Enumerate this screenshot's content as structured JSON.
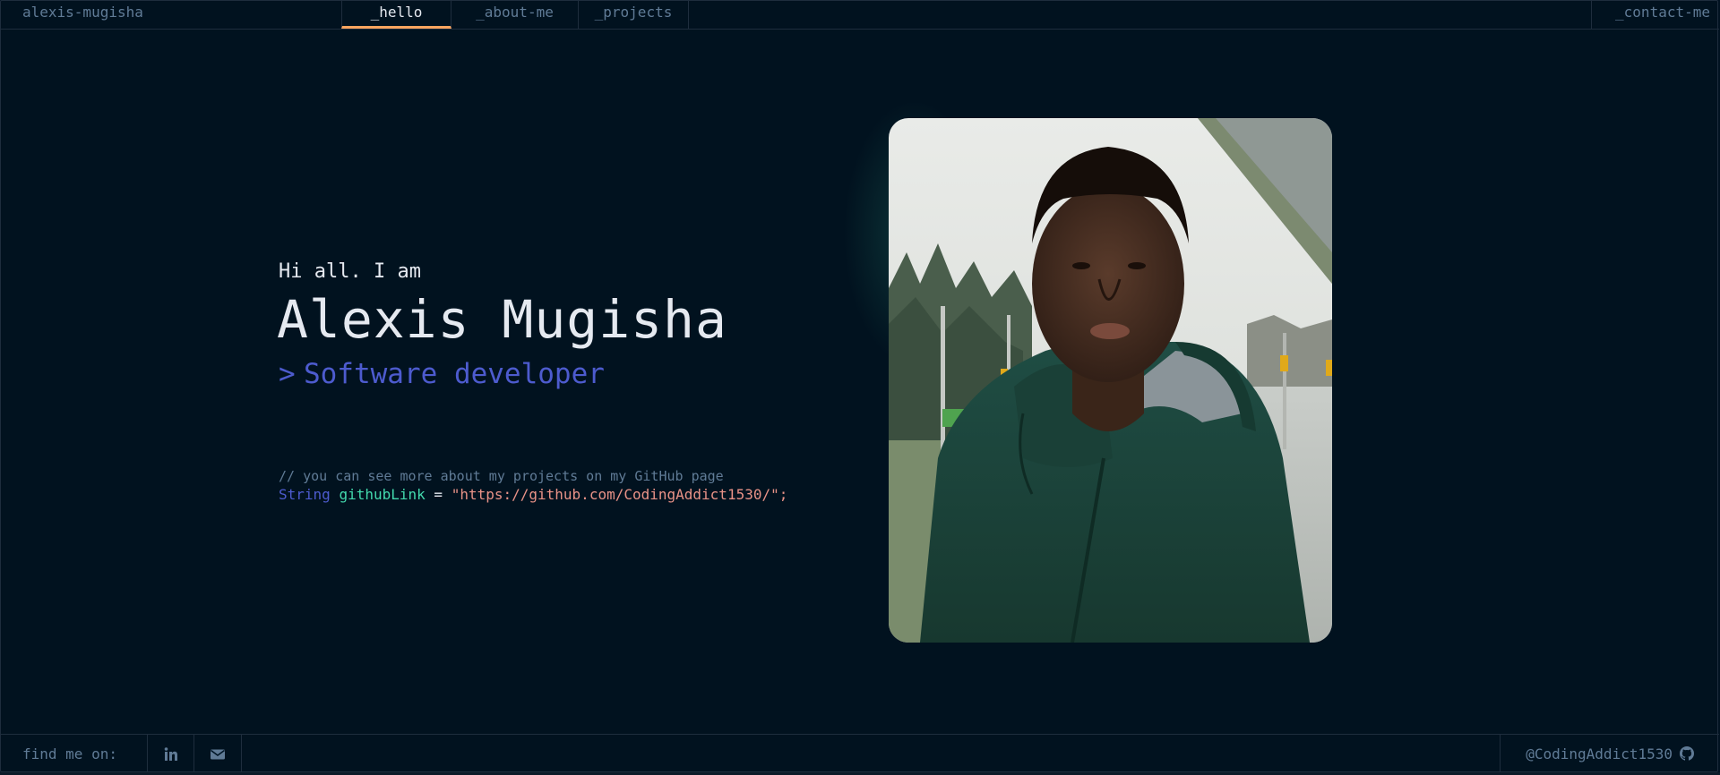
{
  "header": {
    "brand": "alexis-mugisha",
    "tabs": [
      {
        "label": "_hello",
        "active": true
      },
      {
        "label": "_about-me",
        "active": false
      },
      {
        "label": "_projects",
        "active": false
      }
    ],
    "contact_tab": "_contact-me"
  },
  "hero": {
    "greeting": "Hi all. I am",
    "name": "Alexis Mugisha",
    "role_prompt": ">",
    "role": "Software developer",
    "comment": "// you can see more about my projects on my GitHub page",
    "code": {
      "type_keyword": "String",
      "variable": "githubLink",
      "operator": "=",
      "value": "\"https://github.com/CodingAddict1530/\";"
    }
  },
  "footer": {
    "find_me_label": "find me on:",
    "social_icons": [
      "linkedin-icon",
      "mail-icon"
    ],
    "github_handle": "@CodingAddict1530",
    "github_icon": "github-icon"
  },
  "colors": {
    "background": "#01121f",
    "border": "#1E2D3D",
    "muted_text": "#607B96",
    "primary_text": "#E5E9F0",
    "accent_orange": "#FEA55F",
    "accent_blue": "#4D5BCE",
    "accent_green": "#43D9AD",
    "accent_string": "#E99287"
  }
}
